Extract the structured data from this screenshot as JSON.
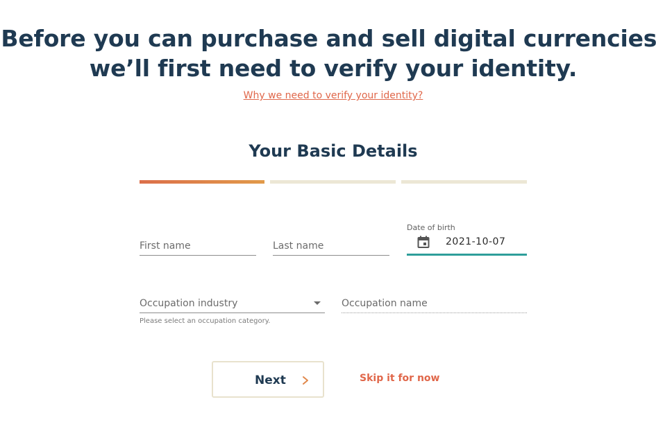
{
  "header": {
    "headline_line1": "Before you can purchase and sell digital currencies,",
    "headline_line2": "we’ll first need to verify your identity.",
    "why_link": "Why we need to verify your identity?"
  },
  "form": {
    "section_title": "Your Basic Details",
    "progress": {
      "current_step": 1,
      "total_steps": 3,
      "active_color": "#dc6f4a",
      "inactive_color": "#ece7d5"
    },
    "first_name": {
      "placeholder": "First name",
      "value": ""
    },
    "last_name": {
      "placeholder": "Last name",
      "value": ""
    },
    "date_of_birth": {
      "label": "Date of birth",
      "value": "2021-10-07",
      "icon": "calendar-icon",
      "focus_color": "#2e9e9a"
    },
    "occupation_industry": {
      "placeholder": "Occupation industry",
      "helper_text": "Please select an occupation category.",
      "icon": "dropdown-caret-icon"
    },
    "occupation_name": {
      "placeholder": "Occupation name",
      "value": ""
    }
  },
  "actions": {
    "next_label": "Next",
    "next_icon": "chevron-right-icon",
    "skip_label": "Skip it for now",
    "accent_color": "#e0674a"
  }
}
